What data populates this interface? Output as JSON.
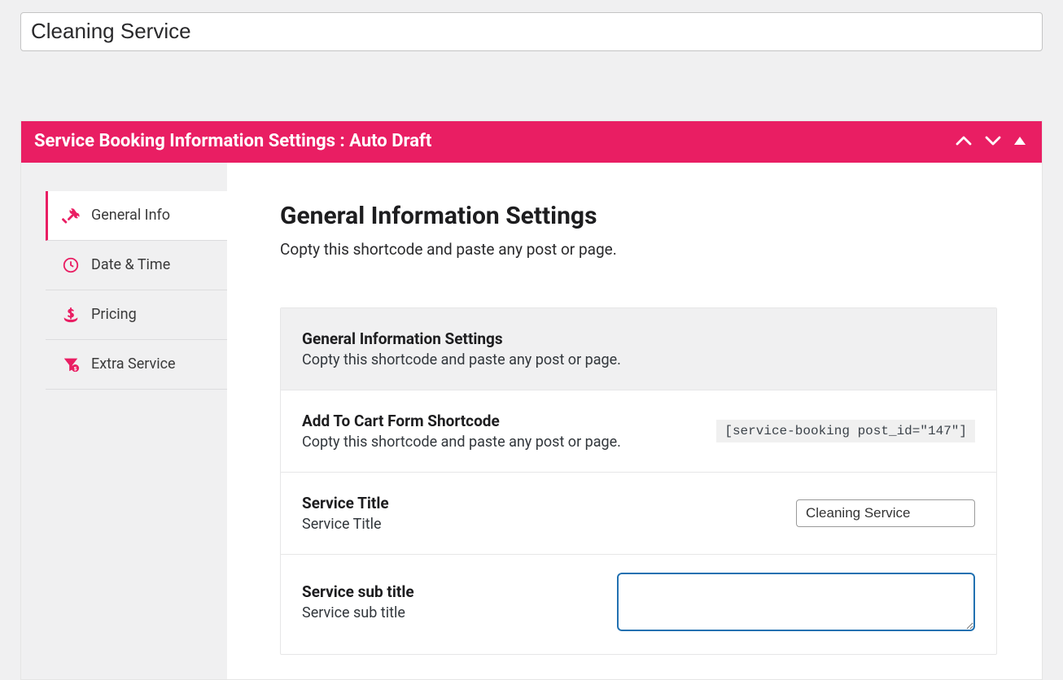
{
  "title_input_value": "Cleaning Service",
  "panel": {
    "header": "Service Booking Information Settings : Auto Draft"
  },
  "sidebar": {
    "items": [
      {
        "label": "General Info"
      },
      {
        "label": "Date & Time"
      },
      {
        "label": "Pricing"
      },
      {
        "label": "Extra Service"
      }
    ]
  },
  "content": {
    "title": "General Information Settings",
    "desc": "Copty this shortcode and paste any post or page.",
    "group_header_title": "General Information Settings",
    "group_header_desc": "Copty this shortcode and paste any post or page.",
    "shortcode_row": {
      "title": "Add To Cart Form Shortcode",
      "desc": "Copty this shortcode and paste any post or page.",
      "code": "[service-booking post_id=\"147\"]"
    },
    "service_title_row": {
      "title": "Service Title",
      "desc": "Service Title",
      "value": "Cleaning Service"
    },
    "sub_title_row": {
      "title": "Service sub title",
      "desc": "Service sub title",
      "value": ""
    }
  }
}
